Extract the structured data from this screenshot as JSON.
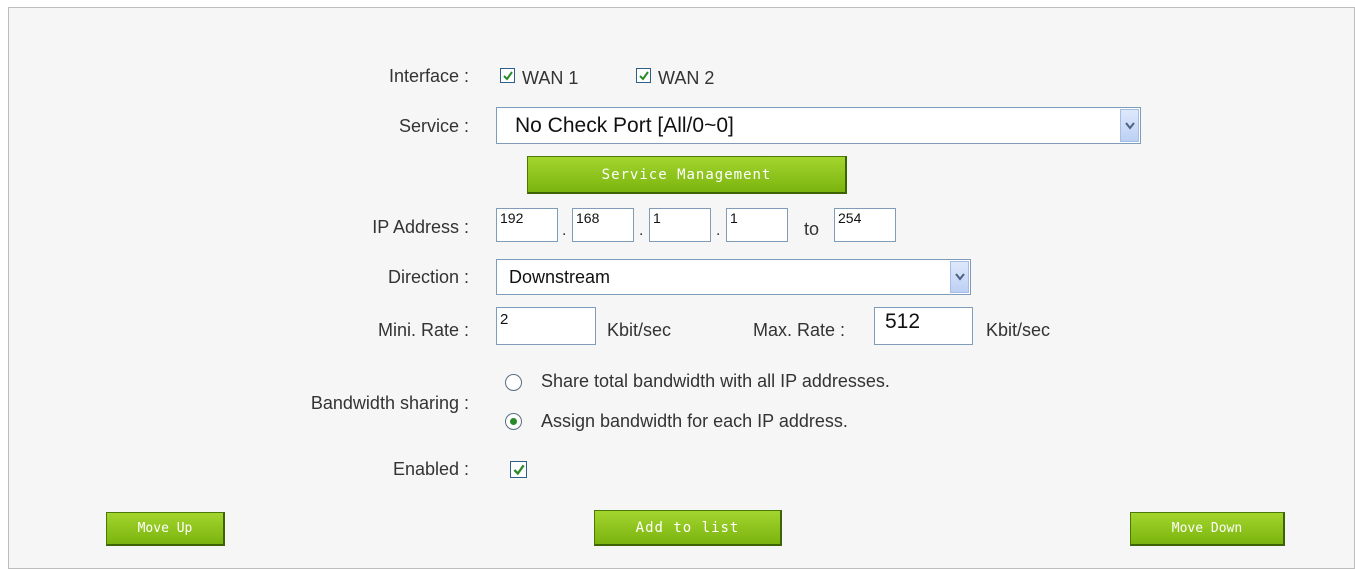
{
  "interface": {
    "label": "Interface :",
    "wan1": {
      "label": "WAN 1",
      "checked": true
    },
    "wan2": {
      "label": "WAN 2",
      "checked": true
    }
  },
  "service": {
    "label": "Service :",
    "selected": "No Check Port [All/0~0]",
    "management_button": "Service Management"
  },
  "ip": {
    "label": "IP Address :",
    "octet1": "192",
    "octet2": "168",
    "octet3": "1",
    "octet4": "1",
    "dot": ".",
    "to_label": "to",
    "end": "254"
  },
  "direction": {
    "label": "Direction :",
    "selected": "Downstream"
  },
  "rate": {
    "min_label": "Mini. Rate :",
    "min_value": "2",
    "min_unit": "Kbit/sec",
    "max_label": "Max. Rate :",
    "max_value": "512",
    "max_unit": "Kbit/sec"
  },
  "sharing": {
    "label": "Bandwidth sharing :",
    "option_share": "Share total bandwidth with all IP addresses.",
    "option_assign": "Assign bandwidth for each IP address.",
    "selected": "assign"
  },
  "enabled": {
    "label": "Enabled :",
    "checked": true
  },
  "buttons": {
    "move_up": "Move Up",
    "add": "Add to list",
    "move_down": "Move Down"
  },
  "colors": {
    "button_green": "#8cc41a",
    "check_green": "#2a8a2a"
  }
}
